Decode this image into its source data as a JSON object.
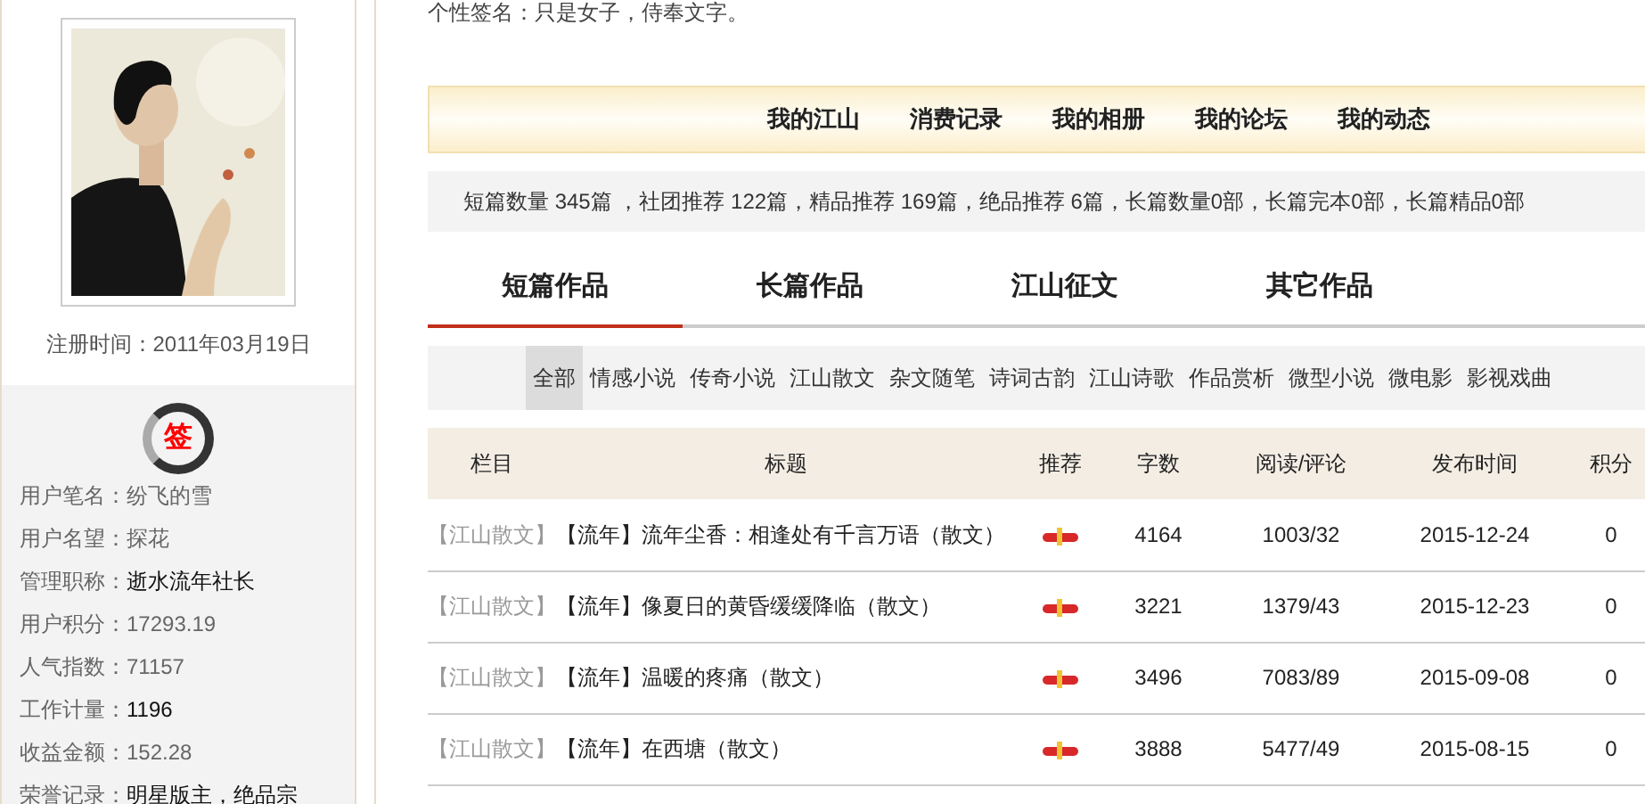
{
  "profile": {
    "registered": "注册时间：2011年03月19日",
    "badge": "签",
    "fields": [
      {
        "label": "用户笔名：",
        "value": "纷飞的雪",
        "highlight": false
      },
      {
        "label": "用户名望：",
        "value": "探花",
        "highlight": false
      },
      {
        "label": "管理职称：",
        "value": "逝水流年社长",
        "highlight": true
      },
      {
        "label": "用户积分：",
        "value": "17293.19",
        "highlight": false
      },
      {
        "label": "人气指数：",
        "value": "71157",
        "highlight": false
      },
      {
        "label": "工作计量：",
        "value": "1196",
        "highlight": true
      },
      {
        "label": "收益金额：",
        "value": "152.28",
        "highlight": false
      },
      {
        "label": "荣誉记录：",
        "value": "明星版主，绝品宗",
        "highlight": true
      }
    ]
  },
  "signature": "个性签名：只是女子，侍奉文字。",
  "nav": [
    "我的江山",
    "消费记录",
    "我的相册",
    "我的论坛",
    "我的动态"
  ],
  "stats": "短篇数量 345篇 ，社团推荐 122篇，精品推荐 169篇，绝品推荐 6篇，长篇数量0部，长篇完本0部，长篇精品0部",
  "tabs": [
    {
      "label": "短篇作品",
      "selected": true
    },
    {
      "label": "长篇作品",
      "selected": false
    },
    {
      "label": "江山征文",
      "selected": false
    },
    {
      "label": "其它作品",
      "selected": false
    }
  ],
  "filters": [
    {
      "label": "全部",
      "selected": true
    },
    {
      "label": "情感小说",
      "selected": false
    },
    {
      "label": "传奇小说",
      "selected": false
    },
    {
      "label": "江山散文",
      "selected": false
    },
    {
      "label": "杂文随笔",
      "selected": false
    },
    {
      "label": "诗词古韵",
      "selected": false
    },
    {
      "label": "江山诗歌",
      "selected": false
    },
    {
      "label": "作品赏析",
      "selected": false
    },
    {
      "label": "微型小说",
      "selected": false
    },
    {
      "label": "微电影",
      "selected": false
    },
    {
      "label": "影视戏曲",
      "selected": false
    }
  ],
  "table": {
    "columns": [
      "栏目",
      "标题",
      "推荐",
      "字数",
      "阅读/评论",
      "发布时间",
      "积分"
    ],
    "rows": [
      {
        "column": "【江山散文】",
        "title": "【流年】流年尘香：相逢处有千言万语（散文）",
        "recommended": true,
        "words": "4164",
        "reads": "1003/32",
        "date": "2015-12-24",
        "points": "0"
      },
      {
        "column": "【江山散文】",
        "title": "【流年】像夏日的黄昏缓缓降临（散文）",
        "recommended": true,
        "words": "3221",
        "reads": "1379/43",
        "date": "2015-12-23",
        "points": "0"
      },
      {
        "column": "【江山散文】",
        "title": "【流年】温暖的疼痛（散文）",
        "recommended": true,
        "words": "3496",
        "reads": "7083/89",
        "date": "2015-09-08",
        "points": "0"
      },
      {
        "column": "【江山散文】",
        "title": "【流年】在西塘（散文）",
        "recommended": true,
        "words": "3888",
        "reads": "5477/49",
        "date": "2015-08-15",
        "points": "0"
      }
    ]
  }
}
